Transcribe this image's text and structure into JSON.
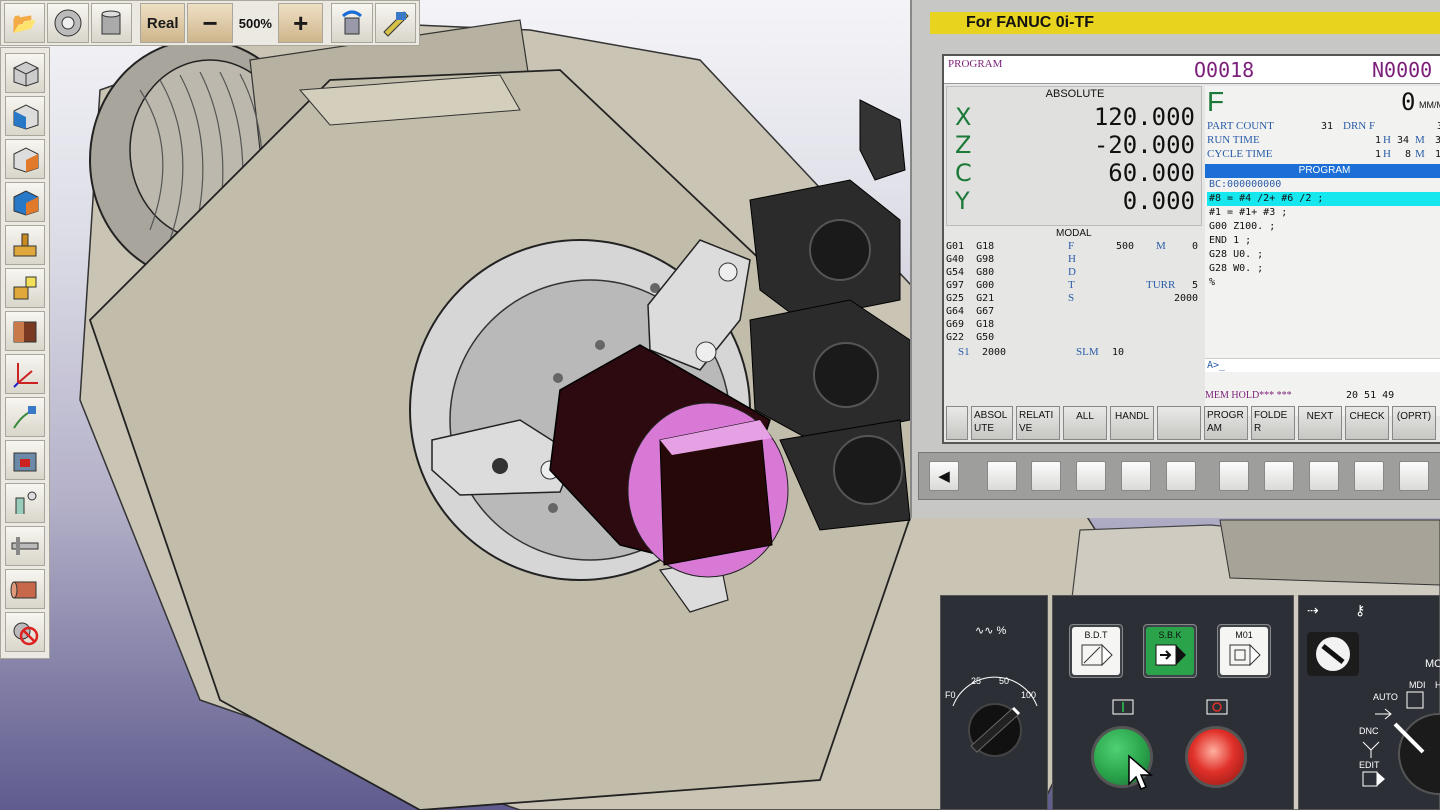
{
  "toolbar": {
    "real_label": "Real",
    "zoom_out_label": "−",
    "zoom_value": "500%",
    "zoom_in_label": "+"
  },
  "fanuc": {
    "title": "For FANUC 0i-TF",
    "screen_title": "PROGRAM",
    "program_number": "O0018",
    "sequence_number": "N0000",
    "absolute_label": "ABSOLUTE",
    "axes": [
      {
        "axis": "X",
        "value": "120.000"
      },
      {
        "axis": "Z",
        "value": "-20.000"
      },
      {
        "axis": "C",
        "value": "60.000"
      },
      {
        "axis": "Y",
        "value": "0.000"
      }
    ],
    "modal_label": "MODAL",
    "modal_g_codes": "G01  G18\nG40  G98\nG54  G80\nG97  G00\nG25  G21\nG64  G67\nG69  G18\nG22  G50",
    "modal_params": [
      {
        "label": "F",
        "value": "500"
      },
      {
        "label": "M",
        "value": "0"
      },
      {
        "label": "H",
        "value": ""
      },
      {
        "label": "D",
        "value": ""
      },
      {
        "label": "T",
        "value": ""
      },
      {
        "label": "TURR",
        "value": "5"
      },
      {
        "label": "S",
        "value": "2000"
      }
    ],
    "s1_label": "S1",
    "s1_value": "2000",
    "slm_label": "SLM",
    "slm_value": "10",
    "feed_label": "F",
    "feed_value": "0",
    "feed_unit": "MM/M",
    "part_count_label": "PART COUNT",
    "part_count_value": "31",
    "drn_label": "DRN F",
    "drn_value": "3",
    "run_time_label": "RUN TIME",
    "run_time_value": "1",
    "run_time_h": "H",
    "run_time_min": "34",
    "run_time_m": "M",
    "run_time_tail": "3",
    "cycle_time_label": "CYCLE TIME",
    "cycle_time_value": "1",
    "cycle_time_h": "H",
    "cycle_time_min": "8",
    "cycle_time_m": "M",
    "cycle_time_tail": "1",
    "program_panel_label": "PROGRAM",
    "program_lines": [
      "BC:000000000",
      "#8 = #4 /2+ #6 /2 ;",
      "#1 = #1+ #3 ;",
      "G00 Z100. ;",
      "END 1 ;",
      "G28 U0. ;",
      "G28 W0. ;",
      "%"
    ],
    "highlight_line_index": 1,
    "command_line": "A>_",
    "status": "MEM HOLD*** ***",
    "clock": "20 51 49",
    "softkeys": [
      "",
      "ABSOLUTE",
      "RELATIVE",
      "ALL",
      "HANDL",
      "",
      "PROGRAM",
      "FOLDER",
      "NEXT",
      "CHECK",
      "(OPRT)"
    ],
    "back_key_label": "◀"
  },
  "operator_panel": {
    "override_label": "%",
    "dial_labels": [
      "F0",
      "25",
      "50",
      "100"
    ],
    "bdt_label": "B.D.T",
    "sbk_label": "S.B.K",
    "m01_label": "M01",
    "mode_labels": [
      "AUTO",
      "MDI",
      "DNC",
      "EDIT",
      "MO",
      "H"
    ]
  },
  "colors": {
    "fanuc_yellow": "#e8d31e",
    "program_purple": "#7b1f78",
    "axis_green": "#1b7a37",
    "program_blue": "#1c6fd6",
    "highlight_cyan": "#16e6ee",
    "cycle_start_green": "#2aa34b",
    "feed_hold_red": "#e0312a",
    "workpiece_pink": "#d879d6"
  }
}
